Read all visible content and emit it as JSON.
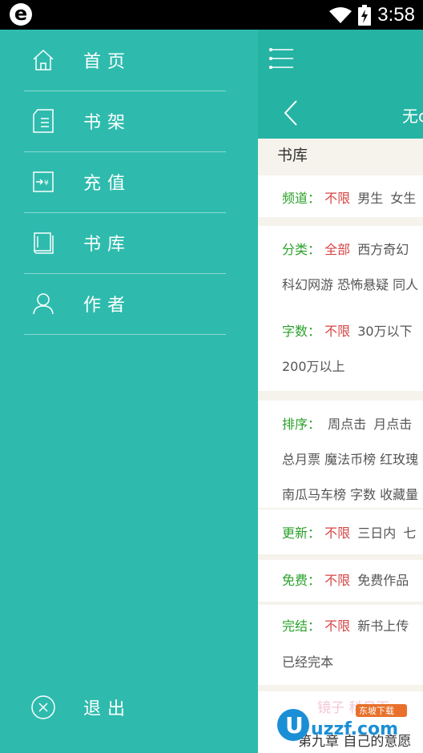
{
  "status_bar": {
    "time": "3:58",
    "logo_letter": "e"
  },
  "drawer": {
    "items": [
      {
        "label": "首页",
        "icon": "home-icon"
      },
      {
        "label": "书架",
        "icon": "bookshelf-icon"
      },
      {
        "label": "充值",
        "icon": "recharge-icon"
      },
      {
        "label": "书库",
        "icon": "library-icon"
      },
      {
        "label": "作者",
        "icon": "author-icon"
      }
    ],
    "logout": {
      "label": "退出",
      "icon": "close-circle-icon"
    }
  },
  "main": {
    "subbar_title": "无c",
    "section_title": "书库",
    "filters": {
      "channel": {
        "label": "频道：",
        "selected": "不限",
        "options": [
          "男生",
          "女生"
        ]
      },
      "category": {
        "label": "分类：",
        "selected": "全部",
        "options": [
          "西方奇幻"
        ],
        "line2": "科幻网游 恐怖悬疑 同人"
      },
      "wordcount": {
        "label": "字数：",
        "selected": "不限",
        "options": [
          "30万以下"
        ],
        "line2": "200万以上"
      },
      "sort": {
        "label": "排序：",
        "options": [
          "周点击",
          "月点击"
        ],
        "line2": "总月票 魔法币榜 红玫瑰",
        "line3": "南瓜马车榜 字数 收藏量"
      },
      "update": {
        "label": "更新：",
        "selected": "不限",
        "options": [
          "三日内",
          "七"
        ]
      },
      "free": {
        "label": "免费：",
        "selected": "不限",
        "options": [
          "免费作品"
        ]
      },
      "finish": {
        "label": "完结：",
        "selected": "不限",
        "options": [
          "新书上传"
        ],
        "line2": "已经完本"
      }
    },
    "article": {
      "faded_text": "镜子 科月百",
      "title": "第九章 自己的意愿"
    }
  },
  "watermark": {
    "text": "uzzf.com",
    "tag": "东坡下载"
  }
}
